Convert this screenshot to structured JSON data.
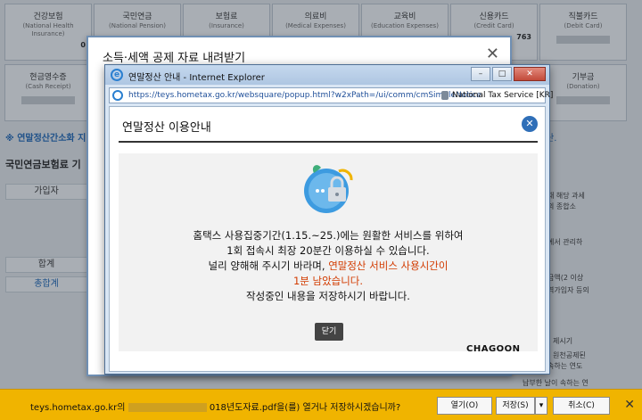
{
  "background": {
    "categories_row1": [
      {
        "ko": "건강보험",
        "en": "(National Health Insurance)",
        "val": "0"
      },
      {
        "ko": "국민연금",
        "en": "(National Pension)",
        "val": ""
      },
      {
        "ko": "보험료",
        "en": "(Insurance)",
        "val": ""
      },
      {
        "ko": "의료비",
        "en": "(Medical Expenses)",
        "val": ""
      },
      {
        "ko": "교육비",
        "en": "(Education Expenses)",
        "val": ""
      },
      {
        "ko": "신용카드",
        "en": "(Credit Card)",
        "val": "763"
      },
      {
        "ko": "직불카드",
        "en": "(Debit Card)",
        "val": ""
      }
    ],
    "categories_row2": [
      {
        "ko": "현금영수증",
        "en": "(Cash Receipt)"
      },
      {
        "ko": "",
        "en": ""
      },
      {
        "ko": "",
        "en": ""
      },
      {
        "ko": "",
        "en": ""
      },
      {
        "ko": "",
        "en": ""
      },
      {
        "ko": "",
        "en": ""
      },
      {
        "ko": "기부금",
        "en": "(Donation)"
      }
    ],
    "link_left": "※ 연말정산간소화 지",
    "link_right": "단.",
    "section_title": "국민연금보험료 기",
    "cell_subscriber": "가입자",
    "cell_total": "합계",
    "cell_grand_total": "총합계",
    "right_texts": [
      "때 해당 과세",
      "의 종합소",
      "에서 관리하",
      "금액(2 이상",
      "역가입자 등의",
      "제시기",
      "원천공제된",
      "속하는 연도",
      "납부한 날이 속하는 연"
    ]
  },
  "outer_dialog": {
    "title": "소득·세액 공제 자료 내려받기",
    "close_glyph": "✕"
  },
  "ie_window": {
    "title": "연말정산 안내 - Internet Explorer",
    "url": "https://teys.hometax.go.kr/websquare/popup.html?w2xPath=/ui/comm/cmSimpleNotice",
    "site_identity": "National Tax Service [KR]",
    "controls": {
      "minimize": "–",
      "maximize": "□",
      "close": "✕"
    }
  },
  "notice": {
    "title": "연말정산 이용안내",
    "close_glyph": "✕",
    "line1": "홈택스 사용집중기간(1.15.~25.)에는 원활한 서비스를 위하여",
    "line2": "1회 접속시 최장 20분간 이용하실 수 있습니다.",
    "line3_black": "널리 양해해 주시기 바라며, ",
    "line3_red": "연말정산 서비스 사용시간이",
    "line4_red": "1분 남았습니다.",
    "line5": "작성중인 내용을 저장하시기 바랍니다.",
    "close_button": "닫기",
    "watermark": "CHAGOON"
  },
  "download_bar": {
    "message_prefix": "teys.hometax.go.kr의",
    "message_suffix": "018년도자료.pdf을(를) 열거나 저장하시겠습니까?",
    "open": "열기(O)",
    "save": "저장(S)",
    "save_arrow": "▾",
    "cancel": "취소(C)",
    "close_glyph": "✕"
  },
  "colors": {
    "accent_blue": "#2f6fb8",
    "warning_red": "#d23b00",
    "download_bar": "#f0b400"
  }
}
